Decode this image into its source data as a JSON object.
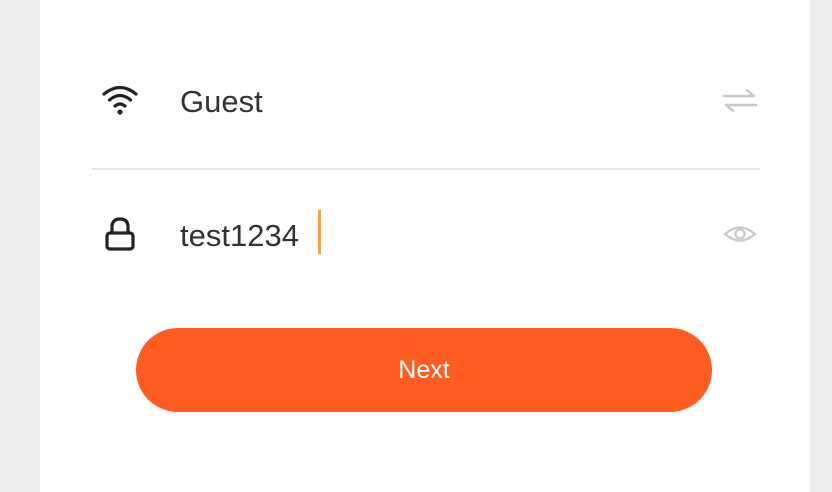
{
  "network": {
    "ssid": "Guest",
    "password_value": "test1234",
    "password_placeholder": ""
  },
  "icons": {
    "wifi": "wifi-icon",
    "switch": "switch-network-icon",
    "lock": "lock-icon",
    "visibility": "eye-icon"
  },
  "actions": {
    "next_label": "Next"
  },
  "colors": {
    "accent": "#ff5c22",
    "cursor": "#f6a04a",
    "text": "#333333",
    "icon_muted": "#c8c8c8",
    "divider": "#e6e6e6",
    "background": "#ededed",
    "panel": "#ffffff"
  }
}
